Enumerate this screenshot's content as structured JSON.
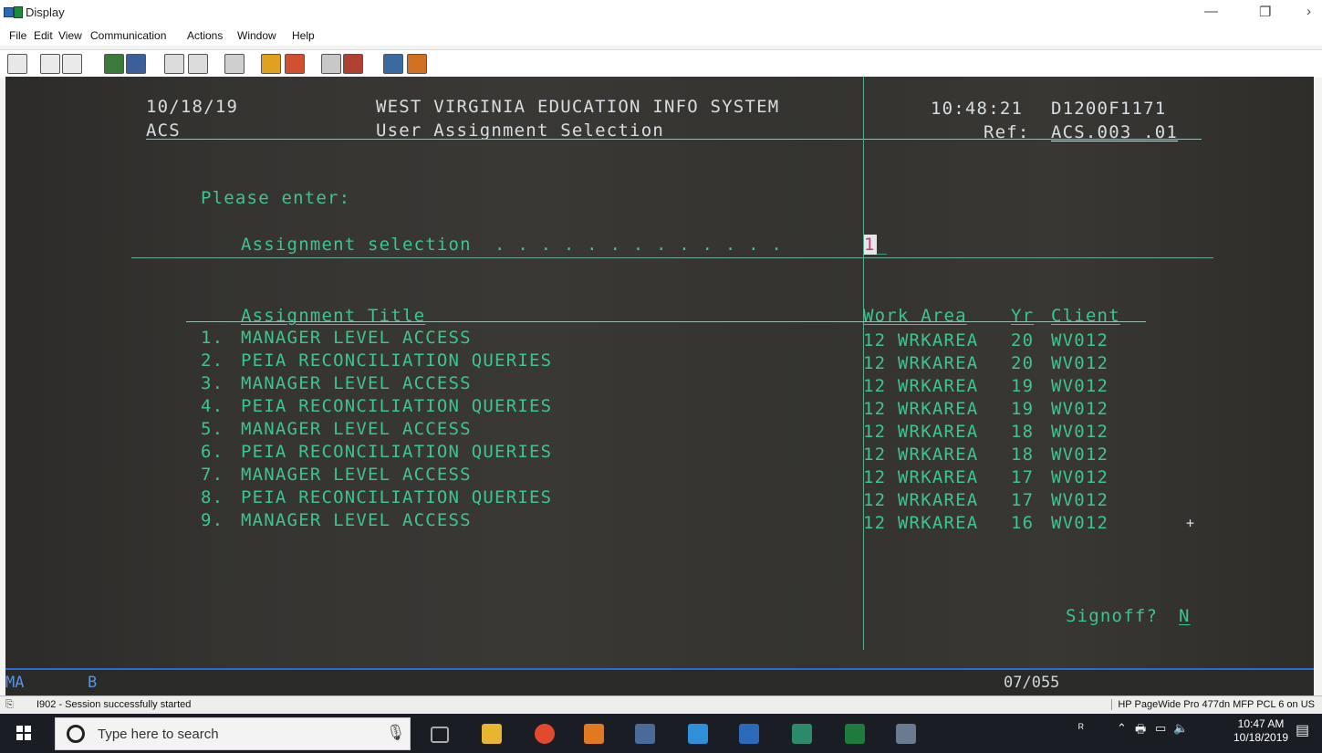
{
  "window": {
    "title": "Display"
  },
  "menu": {
    "items": [
      "File",
      "Edit",
      "View",
      "Communication",
      "Actions",
      "Window",
      "Help"
    ]
  },
  "toolbar": {
    "icons": [
      "display-icon",
      "copy-icon",
      "paste-icon",
      "send-icon",
      "receive-icon",
      "screen-icon",
      "screen2-icon",
      "print-icon",
      "macro-icon",
      "macro2-icon",
      "keypad-icon",
      "keypad2-icon",
      "globe-icon",
      "tag-icon"
    ]
  },
  "terminal": {
    "date": "10/18/19",
    "system": "WEST VIRGINIA EDUCATION INFO SYSTEM",
    "time": "10:48:21",
    "terminal_id": "D1200F1171",
    "app_code": "ACS",
    "subtitle": "User Assignment Selection",
    "ref_label": "Ref:",
    "ref_value": "ACS.003 .01",
    "prompt": "Please enter:",
    "field_label": "Assignment selection  . . . . . . . . . . . . .",
    "field_value": "1",
    "columns": {
      "title": "Assignment Title",
      "work_area": "Work Area",
      "yr": "Yr",
      "client": "Client"
    },
    "rows": [
      {
        "num": "1.",
        "title": "MANAGER LEVEL ACCESS",
        "wa": "12 WRKAREA",
        "yr": "20",
        "client": "WV012"
      },
      {
        "num": "2.",
        "title": "PEIA RECONCILIATION QUERIES",
        "wa": "12 WRKAREA",
        "yr": "20",
        "client": "WV012"
      },
      {
        "num": "3.",
        "title": "MANAGER LEVEL ACCESS",
        "wa": "12 WRKAREA",
        "yr": "19",
        "client": "WV012"
      },
      {
        "num": "4.",
        "title": "PEIA RECONCILIATION QUERIES",
        "wa": "12 WRKAREA",
        "yr": "19",
        "client": "WV012"
      },
      {
        "num": "5.",
        "title": "MANAGER LEVEL ACCESS",
        "wa": "12 WRKAREA",
        "yr": "18",
        "client": "WV012"
      },
      {
        "num": "6.",
        "title": "PEIA RECONCILIATION QUERIES",
        "wa": "12 WRKAREA",
        "yr": "18",
        "client": "WV012"
      },
      {
        "num": "7.",
        "title": "MANAGER LEVEL ACCESS",
        "wa": "12 WRKAREA",
        "yr": "17",
        "client": "WV012"
      },
      {
        "num": "8.",
        "title": "PEIA RECONCILIATION QUERIES",
        "wa": "12 WRKAREA",
        "yr": "17",
        "client": "WV012"
      },
      {
        "num": "9.",
        "title": "MANAGER LEVEL ACCESS",
        "wa": "12 WRKAREA",
        "yr": "16",
        "client": "WV012"
      }
    ],
    "more_marker": "+",
    "signoff_label": "Signoff?",
    "signoff_value": "N"
  },
  "oia": {
    "left": "MA",
    "mode": "B",
    "cursor": "07/055"
  },
  "status": {
    "message": "I902 - Session successfully started",
    "printer": "HP PageWide Pro 477dn MFP PCL 6 on US"
  },
  "taskbar": {
    "search_placeholder": "Type here to search",
    "time": "10:47 AM",
    "date": "10/18/2019"
  },
  "colors": {
    "terminal_green": "#3ec48c",
    "terminal_white": "#d7dde0",
    "oia_blue": "#5b92e0",
    "cursor_pink": "#c43b8a"
  }
}
